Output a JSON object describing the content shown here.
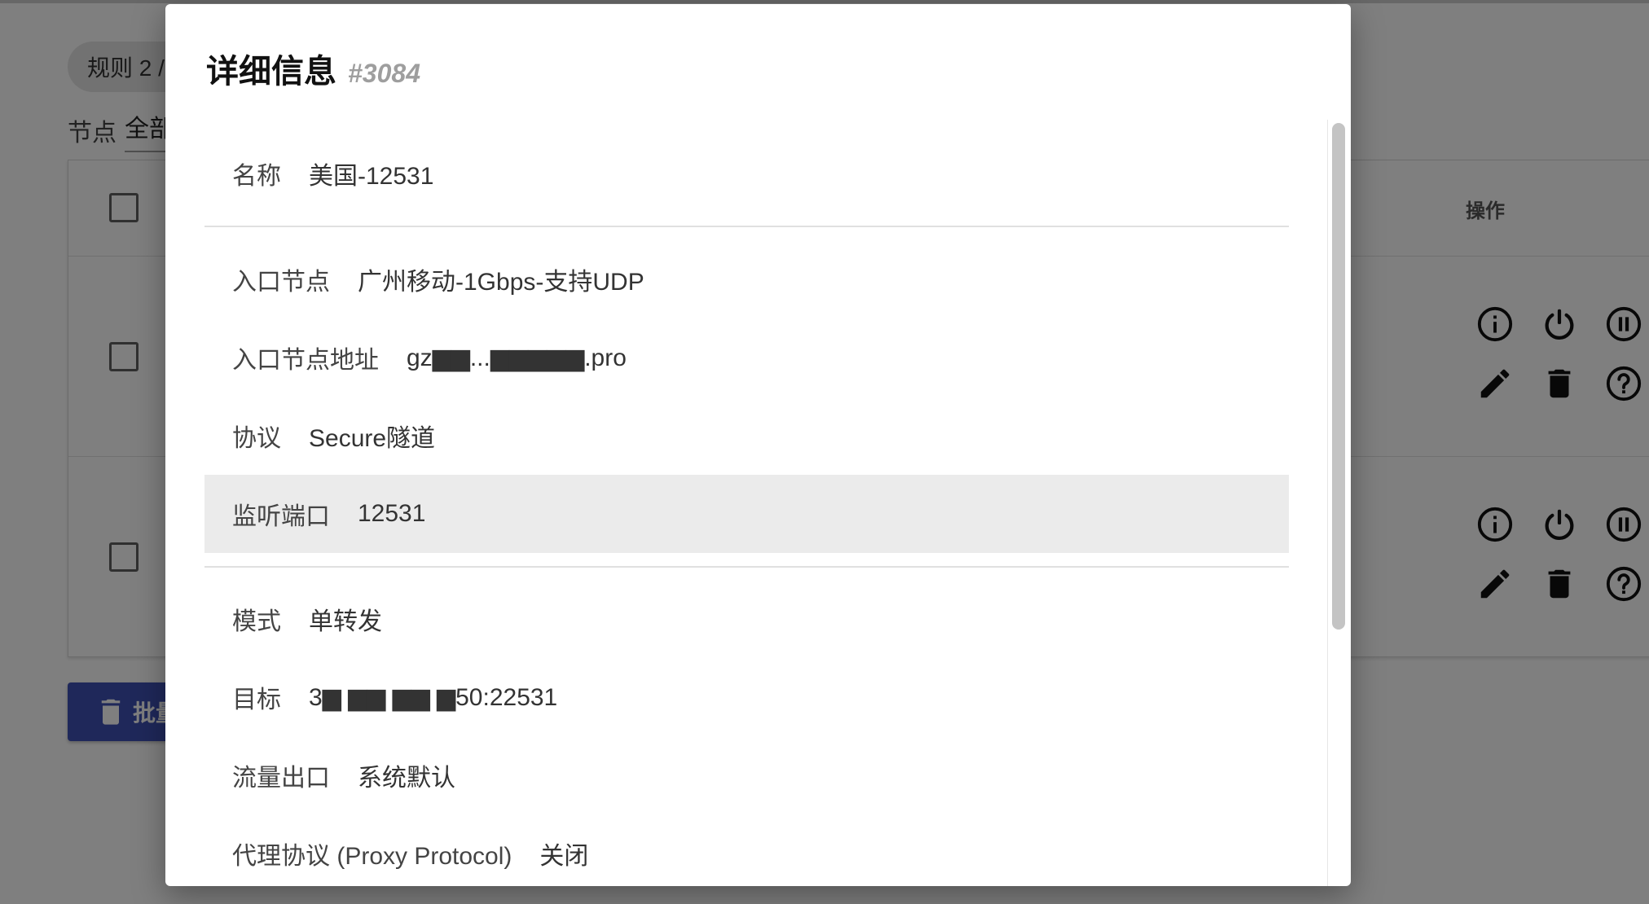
{
  "background": {
    "rule_chip": "规则 2 /",
    "filter": {
      "label": "节点",
      "value": "全部"
    },
    "table": {
      "ops_header": "操作",
      "rows": [
        {
          "icons": [
            "info-icon",
            "power-icon",
            "pause-icon",
            "edit-icon",
            "delete-icon",
            "help-icon"
          ]
        },
        {
          "icons": [
            "info-icon",
            "power-icon",
            "pause-icon",
            "edit-icon",
            "delete-icon",
            "help-icon"
          ]
        }
      ]
    },
    "batch_button": {
      "label": "批量",
      "icon": "trash-icon"
    }
  },
  "dialog": {
    "title": "详细信息",
    "id": "#3084",
    "fields": [
      {
        "key": "名称",
        "value": "美国-12531"
      },
      {
        "key": "入口节点",
        "value": "广州移动-1Gbps-支持UDP"
      },
      {
        "key": "入口节点地址",
        "value": "gz▆▆...▆▆▆▆▆.pro"
      },
      {
        "key": "协议",
        "value": "Secure隧道"
      },
      {
        "key": "监听端口",
        "value": "12531"
      },
      {
        "key": "模式",
        "value": "单转发"
      },
      {
        "key": "目标",
        "value": "3▆ ▆▆ ▆▆ ▆50:22531"
      },
      {
        "key": "流量出口",
        "value": "系统默认"
      },
      {
        "key": "代理协议 (Proxy Protocol)",
        "value": "关闭"
      }
    ]
  },
  "colors": {
    "primary": "#3f51b5",
    "highlight_row": "#ebebeb",
    "scrim": "rgba(0,0,0,0.5)"
  }
}
